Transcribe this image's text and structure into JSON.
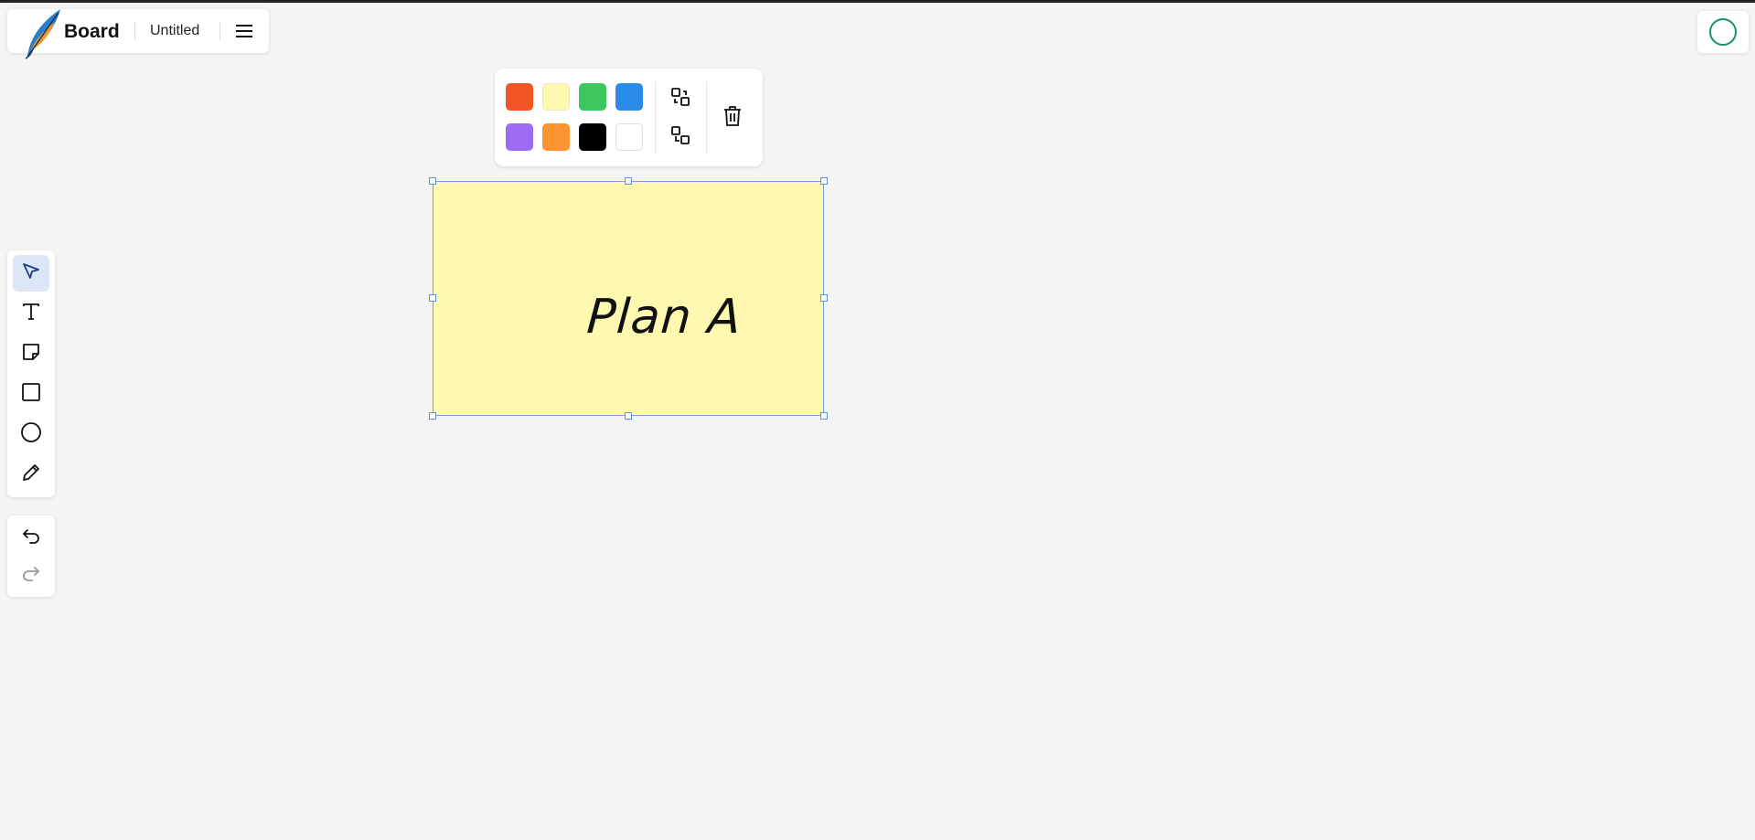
{
  "header": {
    "app_name": "Board",
    "doc_title": "Untitled",
    "menu_icon": "hamburger-menu-icon",
    "logo_icon": "feather-logo"
  },
  "user": {
    "avatar_icon": "circle-avatar-icon",
    "avatar_color": "#1b8f71"
  },
  "color_toolbar": {
    "colors": [
      {
        "name": "red-orange",
        "hex": "#f05523"
      },
      {
        "name": "light-yellow",
        "hex": "#fff8b0"
      },
      {
        "name": "green",
        "hex": "#3cc85e"
      },
      {
        "name": "blue",
        "hex": "#2a8ce8"
      },
      {
        "name": "purple",
        "hex": "#9d6cf2"
      },
      {
        "name": "orange",
        "hex": "#fd9430"
      },
      {
        "name": "black",
        "hex": "#000000"
      },
      {
        "name": "white",
        "hex": "#ffffff"
      }
    ],
    "actions": [
      "bring-to-front-icon",
      "send-to-back-icon",
      "trash-icon"
    ]
  },
  "tools": [
    {
      "name": "select",
      "icon": "cursor-arrow-icon",
      "active": true
    },
    {
      "name": "text",
      "icon": "text-icon",
      "active": false
    },
    {
      "name": "sticky-note",
      "icon": "sticky-note-icon",
      "active": false
    },
    {
      "name": "rectangle",
      "icon": "square-icon",
      "active": false
    },
    {
      "name": "ellipse",
      "icon": "circle-icon",
      "active": false
    },
    {
      "name": "pen",
      "icon": "pencil-icon",
      "active": false
    }
  ],
  "history": [
    "undo-icon",
    "redo-icon"
  ],
  "canvas": {
    "note": {
      "text": "Plan A",
      "color": "#fff8b0",
      "selected": true
    }
  }
}
